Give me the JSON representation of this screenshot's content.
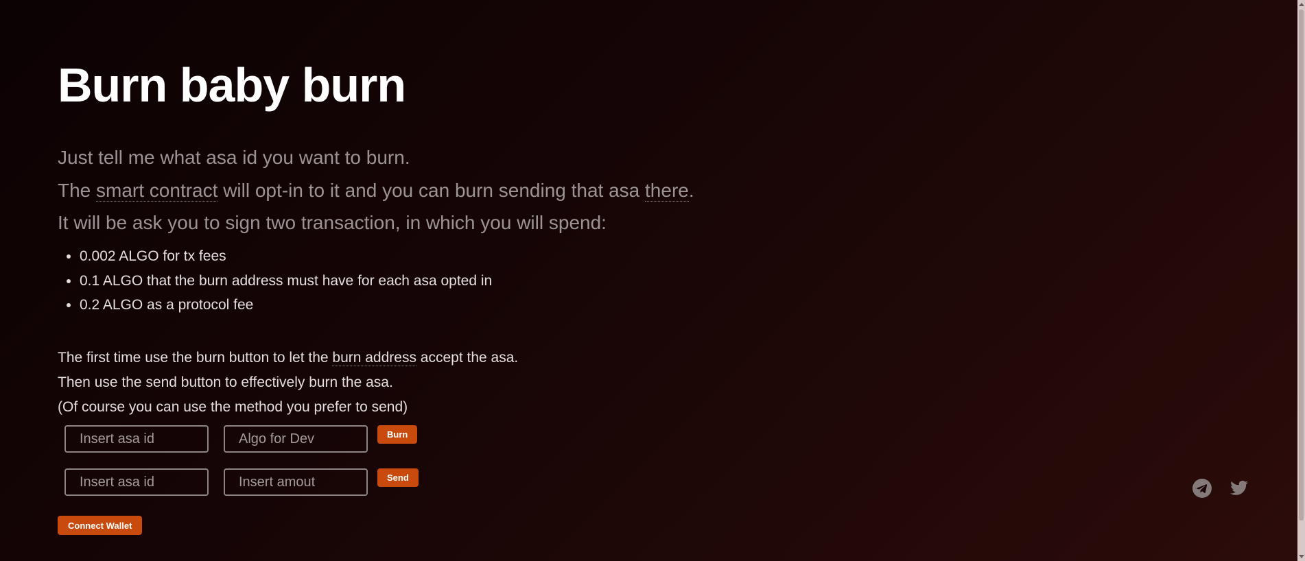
{
  "header": {
    "title": "Burn baby burn"
  },
  "lead": {
    "line1": "Just tell me what asa id you want to burn.",
    "line2_prefix": "The ",
    "line2_link1": "smart contract",
    "line2_middle": " will opt-in to it and you can burn sending that asa ",
    "line2_link2": "there",
    "line2_suffix": ".",
    "line3": "It will be ask you to sign two transaction, in which you will spend:"
  },
  "fees": [
    "0.002 ALGO for tx fees",
    "0.1 ALGO that the burn address must have for each asa opted in",
    "0.2 ALGO as a protocol fee"
  ],
  "instructions": {
    "line1_prefix": "The first time use the burn button to let the ",
    "line1_link": "burn address",
    "line1_suffix": " accept the asa.",
    "line2": "Then use the send button to effectively burn the asa.",
    "line3": "(Of course you can use the method you prefer to send)"
  },
  "burn_form": {
    "asa_placeholder": "Insert asa id",
    "dev_placeholder": "Algo for Dev",
    "button_label": "Burn"
  },
  "send_form": {
    "asa_placeholder": "Insert asa id",
    "amount_placeholder": "Insert amout",
    "button_label": "Send"
  },
  "wallet": {
    "connect_label": "Connect Wallet"
  },
  "social": {
    "icons": [
      "telegram-icon",
      "twitter-icon"
    ]
  },
  "colors": {
    "accent": "#c84a0c",
    "background": "#120404",
    "title": "#ffffff",
    "muted_text": "#9c9494"
  }
}
